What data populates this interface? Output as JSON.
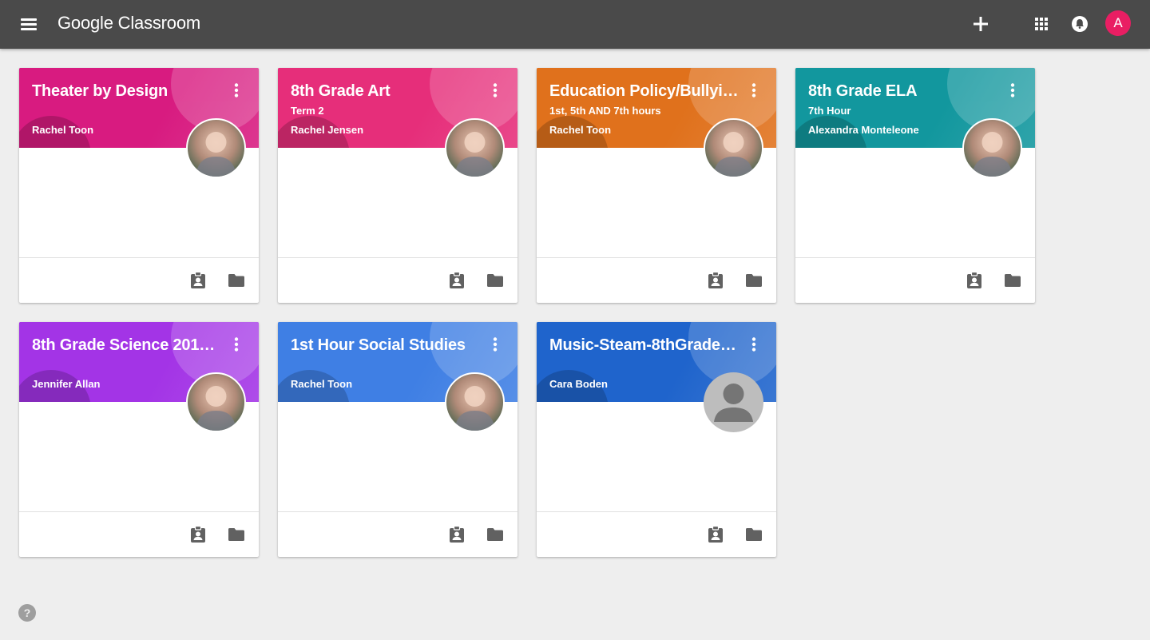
{
  "app": {
    "brand": "Google Classroom"
  },
  "colors": {
    "topbar": "#4a4a4a",
    "avatar_bg": "#e91e63"
  },
  "topbar": {
    "icons": [
      "menu-icon",
      "plus-icon",
      "apps-grid-icon",
      "notifications-icon"
    ],
    "account_initial": "A"
  },
  "classes": [
    {
      "title": "Theater by Design",
      "section": "",
      "teacher": "Rachel Toon",
      "theme_color": "#d81b80",
      "photo": "profile-photo"
    },
    {
      "title": "8th Grade Art",
      "section": "Term 2",
      "teacher": "Rachel Jensen",
      "theme_color": "#e62e7a",
      "photo": "profile-photo"
    },
    {
      "title": "Education Policy/Bullyin...",
      "section": "1st, 5th AND 7th hours",
      "teacher": "Rachel Toon",
      "theme_color": "#e0711c",
      "photo": "profile-photo"
    },
    {
      "title": "8th Grade ELA",
      "section": "7th Hour",
      "teacher": "Alexandra Monteleone",
      "theme_color": "#12979e",
      "photo": "profile-photo"
    },
    {
      "title": "8th Grade Science 2018-...",
      "section": "",
      "teacher": "Jennifer Allan",
      "theme_color": "#a334e6",
      "photo": "profile-photo"
    },
    {
      "title": "1st Hour Social Studies",
      "section": "",
      "teacher": "Rachel Toon",
      "theme_color": "#3f7fe4",
      "photo": "profile-photo"
    },
    {
      "title": "Music-Steam-8thGradeB...",
      "section": "",
      "teacher": "Cara Boden",
      "theme_color": "#1f64cc",
      "photo": "default-avatar"
    }
  ],
  "card_actions": [
    "assignment-icon",
    "folder-icon"
  ],
  "help": {
    "label": "?"
  }
}
